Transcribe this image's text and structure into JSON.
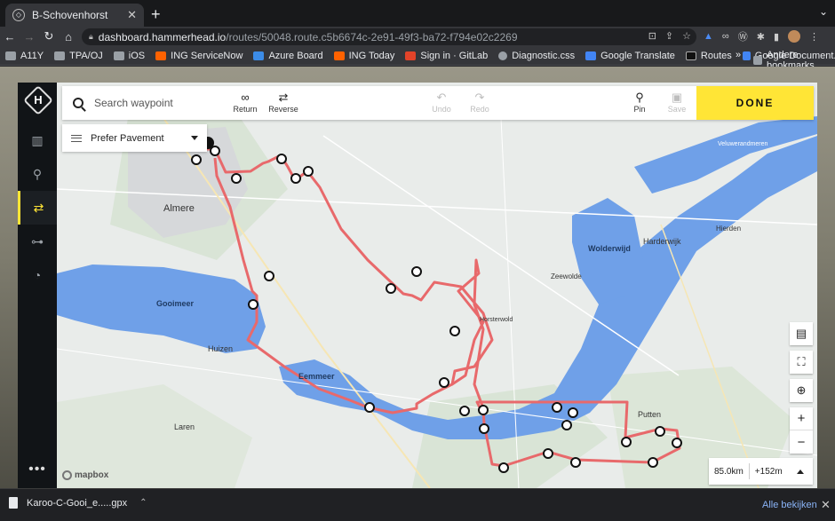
{
  "browser": {
    "tab_title": "B-Schovenhorst",
    "tab_close": "✕",
    "new_tab": "+",
    "tab_menu": "⌄",
    "url_host": "dashboard.hammerhead.io",
    "url_path": "/routes/50048.route.c5b6674c-2e91-49f3-ba72-f794e02c2269",
    "nav": {
      "back": "←",
      "forward": "→",
      "reload": "↻",
      "home": "⌂"
    }
  },
  "bookmarks": {
    "items": [
      {
        "label": "A11Y",
        "color": "#9aa0a6"
      },
      {
        "label": "TPA/OJ",
        "color": "#9aa0a6"
      },
      {
        "label": "iOS",
        "color": "#9aa0a6"
      },
      {
        "label": "ING ServiceNow",
        "color": "#ff6200"
      },
      {
        "label": "Azure Board",
        "color": "#3c8ce7"
      },
      {
        "label": "ING Today",
        "color": "#ff6200"
      },
      {
        "label": "Sign in · GitLab",
        "color": "#e24329"
      },
      {
        "label": "Diagnostic.css",
        "color": "#9aa0a6"
      },
      {
        "label": "Google Translate",
        "color": "#4285f4"
      },
      {
        "label": "Routes",
        "color": "#333333"
      },
      {
        "label": "Google Document...",
        "color": "#4285f4"
      }
    ],
    "more": "»",
    "other": "Andere bookmarks"
  },
  "sidebar": {
    "logo_letter": "H",
    "more": "•••"
  },
  "toolbar": {
    "search_placeholder": "Search waypoint",
    "return_label": "Return",
    "reverse_label": "Reverse",
    "undo_label": "Undo",
    "redo_label": "Redo",
    "pin_label": "Pin",
    "save_label": "Save",
    "done_label": "DONE"
  },
  "preference": {
    "label": "Prefer Pavement"
  },
  "map": {
    "labels": {
      "almere": "Almere",
      "gooimeer": "Gooimeer",
      "huizen": "Huizen",
      "eemmeer": "Eemmeer",
      "laren": "Laren",
      "wolderwijd": "Wolderwijd",
      "harderwijk": "Harderwijk",
      "hierden": "Hierden",
      "zeewolde": "Zeewolde",
      "horsterwold": "Horsterwold",
      "putten": "Putten",
      "veluwerandmeren": "Veluwerandmeren"
    },
    "attribution": "mapbox",
    "zoom_in": "+",
    "zoom_out": "−",
    "colors": {
      "route": "#e8696b",
      "water": "#6fa0e8",
      "land": "#e9ecea"
    }
  },
  "route_stats": {
    "distance": "85.0km",
    "elevation": "+152m"
  },
  "downloads": {
    "file_name": "Karoo-C-Gooi_e.....gpx",
    "show_all": "Alle bekijken",
    "close": "✕"
  }
}
